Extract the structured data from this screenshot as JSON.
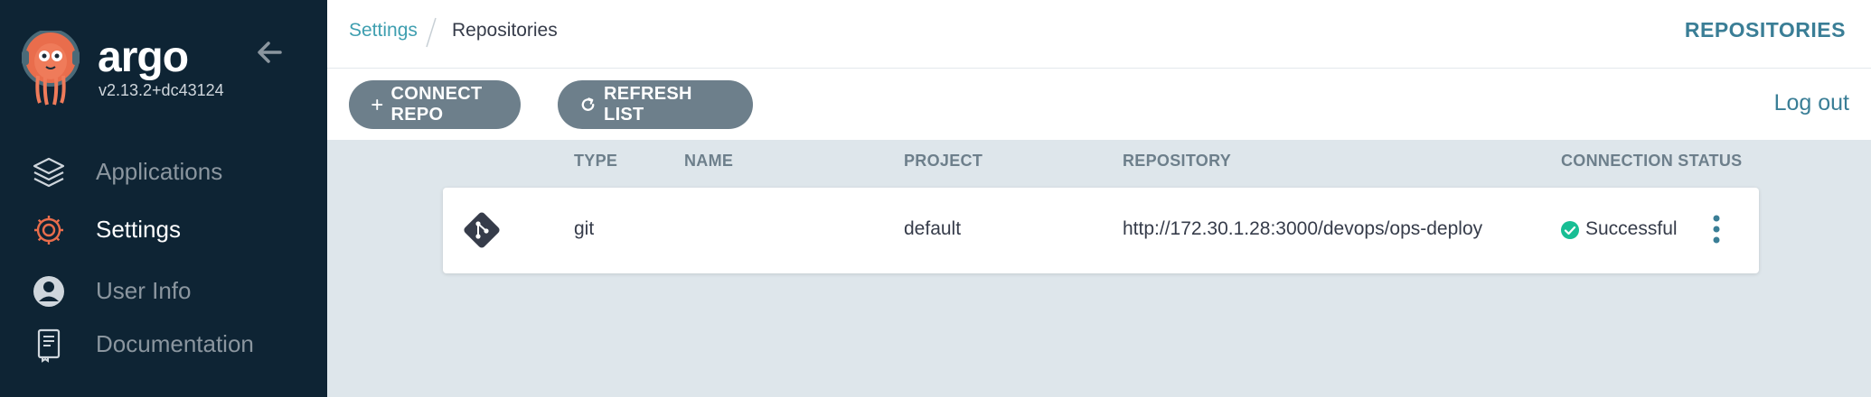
{
  "app": {
    "name": "argo",
    "version": "v2.13.2+dc43124"
  },
  "sidebar": {
    "items": [
      {
        "label": "Applications",
        "icon": "stack-layers-icon",
        "active": false
      },
      {
        "label": "Settings",
        "icon": "gear-icon",
        "active": true
      },
      {
        "label": "User Info",
        "icon": "user-circle-icon",
        "active": false
      },
      {
        "label": "Documentation",
        "icon": "book-icon",
        "active": false
      }
    ]
  },
  "breadcrumb": {
    "parent": "Settings",
    "current": "Repositories"
  },
  "page_title": "REPOSITORIES",
  "toolbar": {
    "connect_label": "CONNECT REPO",
    "refresh_label": "REFRESH LIST",
    "logout_label": "Log out"
  },
  "table": {
    "columns": [
      "TYPE",
      "NAME",
      "PROJECT",
      "REPOSITORY",
      "CONNECTION STATUS"
    ],
    "rows": [
      {
        "type": "git",
        "name": "",
        "project": "default",
        "repository": "http://172.30.1.28:3000/devops/ops-deploy",
        "status": "Successful"
      }
    ]
  },
  "colors": {
    "sidebar_bg": "#0e2434",
    "accent": "#3a7e96",
    "button_bg": "#6d7f8b",
    "success": "#18be94",
    "content_bg": "#dee6eb"
  }
}
